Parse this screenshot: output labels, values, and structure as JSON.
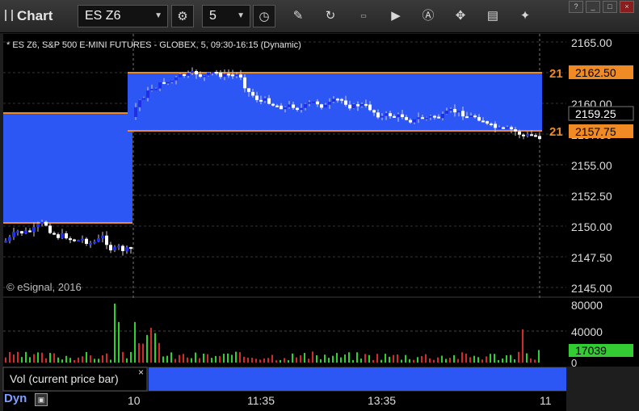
{
  "toolbar": {
    "app_title": "Chart",
    "symbol": "ES Z6",
    "interval": "5",
    "icons": [
      "settings-icon",
      "clock-icon",
      "pencil-icon",
      "refresh-icon",
      "get-icon",
      "play-icon",
      "alert-icon",
      "tools-icon",
      "comment-icon",
      "twitter-icon"
    ]
  },
  "window_buttons": [
    "help",
    "minimize",
    "maximize",
    "close"
  ],
  "chart_header": "* ES Z6, S&P 500 E-MINI FUTURES - GLOBEX, 5, 09:30-16:15 (Dynamic)",
  "copyright": "© eSignal, 2016",
  "colors": {
    "background": "#000000",
    "zone_fill": "#2d57f5",
    "level_line": "#f08a24",
    "up_candle": "#ffffff",
    "down_candle": "#1f2fe8",
    "volume_up": "#2ed12e",
    "volume_down": "#d22b2b",
    "current_volume_tag": "#33cc33"
  },
  "price_axis": {
    "ticks": [
      "2165.00",
      "2162.50",
      "2160.00",
      "2157.50",
      "2155.00",
      "2152.50",
      "2150.00",
      "2147.50",
      "2145.00"
    ],
    "high_tag": "2162.50",
    "last_tag": "2159.25",
    "low_tag": "2157.75",
    "level_label_high": "21",
    "level_label_low": "21"
  },
  "volume_axis": {
    "ticks": [
      "80000",
      "40000",
      "0"
    ],
    "current_value": "17039"
  },
  "indicator_label": "Vol (current price bar)",
  "indicator_close": "×",
  "time_axis": {
    "ticks": [
      "10",
      "11:35",
      "13:35",
      "11"
    ]
  },
  "footer": {
    "mode": "Dyn",
    "lock_icon": "lock-icon"
  },
  "chart_data": {
    "type": "candlestick",
    "title": "* ES Z6, S&P 500 E-MINI FUTURES - GLOBEX, 5, 09:30-16:15 (Dynamic)",
    "ylim": [
      2145,
      2165.5
    ],
    "zones": [
      {
        "day": "previous",
        "high": 2159.25,
        "low": 2150.3
      },
      {
        "day": "current",
        "high": 2162.5,
        "low": 2157.75
      }
    ],
    "x_ticks": [
      "10",
      "11:35",
      "13:35",
      "11"
    ],
    "series": [
      {
        "name": "Vol (current price bar)",
        "last_value": 17039,
        "ylim": [
          0,
          80000
        ]
      }
    ]
  }
}
